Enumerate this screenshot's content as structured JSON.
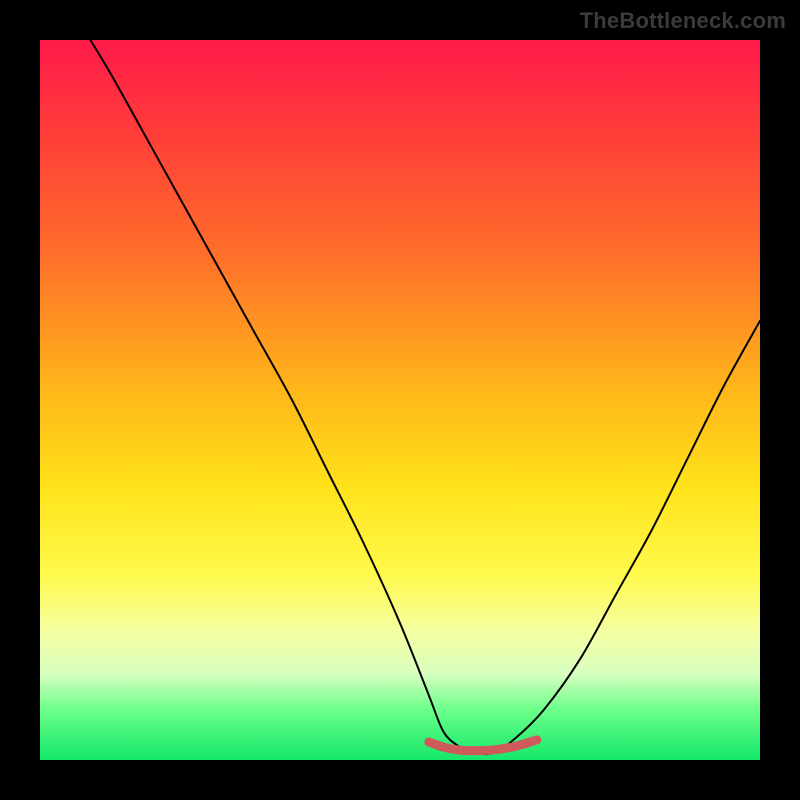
{
  "watermark": {
    "text": "TheBottleneck.com"
  },
  "chart_data": {
    "type": "line",
    "title": "",
    "xlabel": "",
    "ylabel": "",
    "xlim": [
      0,
      100
    ],
    "ylim": [
      0,
      100
    ],
    "grid": false,
    "legend": false,
    "annotations": [],
    "series": [
      {
        "name": "bottleneck-curve",
        "color": "#000000",
        "x": [
          7,
          10,
          15,
          20,
          25,
          30,
          35,
          40,
          45,
          50,
          54,
          56,
          58,
          60,
          63,
          66,
          70,
          75,
          80,
          85,
          90,
          95,
          100
        ],
        "y": [
          100,
          95,
          86,
          77,
          68,
          59,
          50,
          40,
          30,
          19,
          9,
          4,
          2,
          1,
          1,
          3,
          7,
          14,
          23,
          32,
          42,
          52,
          61
        ]
      },
      {
        "name": "green-band",
        "color": "#cf5a5a",
        "x": [
          54,
          56,
          58,
          60,
          63,
          66,
          69
        ],
        "y": [
          2.5,
          1.8,
          1.4,
          1.3,
          1.4,
          1.9,
          2.8
        ]
      }
    ]
  }
}
